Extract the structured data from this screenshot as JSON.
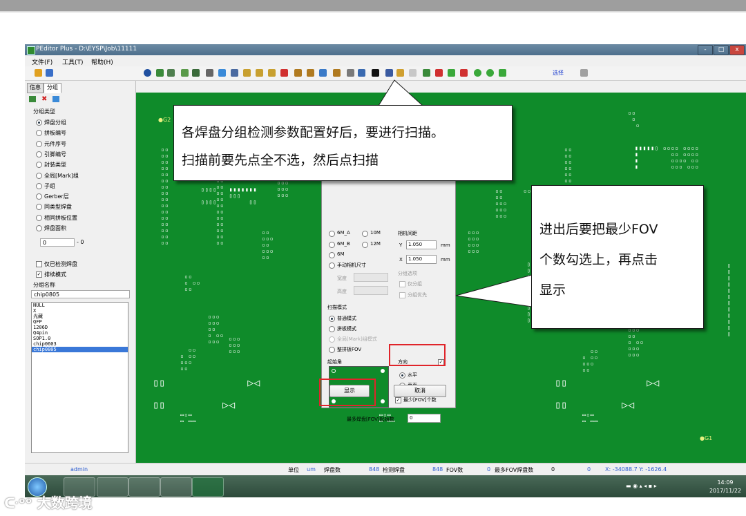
{
  "window": {
    "title": "PEditor Plus - D:\\EYSP\\Job\\11111",
    "min_label": "-",
    "max_label": "□",
    "close_label": "x"
  },
  "menu": {
    "file": "文件(F)",
    "tools": "工具(T)",
    "help": "帮助(H)"
  },
  "toolbar": {
    "select_label": "选择"
  },
  "left_panel": {
    "tabs": [
      "信息",
      "分组"
    ],
    "group_type_label": "分组类型",
    "group_types": [
      "焊盘分组",
      "拼板编号",
      "元件序号",
      "引脚编号",
      "封装类型",
      "全局[Mark]组",
      "子组",
      "Gerber层",
      "同类型焊盘",
      "相同拼板位置",
      "焊盘面积"
    ],
    "range_from": "0",
    "range_sep": "- 0",
    "only_detected": "仅已检测焊盘",
    "sort_mode": "排续模式",
    "group_name_label": "分组名称",
    "group_name_value": "chip0805",
    "list": [
      "NULL",
      "X",
      "光藏",
      "QFP",
      "1206D",
      "Q4pin",
      "SOP1.0",
      "chip0603",
      "chip0805"
    ],
    "admin": "admin"
  },
  "board": {
    "fid1": "G1",
    "fid2": "G2"
  },
  "dialog": {
    "opt_6a": "6M_A",
    "opt_6b": "6M_B",
    "opt_6m": "6M",
    "opt_10m": "10M",
    "opt_12m": "12M",
    "manual": "手动相机尺寸",
    "width": "宽度",
    "height": "高度",
    "cam_spacing": "相机间距",
    "y_label": "Y",
    "y_value": "1.050",
    "x_label": "X",
    "x_value": "1.050",
    "unit": "mm",
    "group_opts": "分组选项",
    "only_group": "仅分组",
    "group_priority": "分组优先",
    "scan_mode": "扫描模式",
    "modes": [
      "普通模式",
      "拼板模式",
      "全局[Mark]组模式",
      "整拼板FOV"
    ],
    "start_corner": "起始角",
    "direction": "方向",
    "horizontal": "水平",
    "vertical": "垂直",
    "min_fov": "最少[FOV]个数",
    "max_pads_label": "最多焊盘[FOV]起始数",
    "max_pads_value": "0",
    "show": "显示",
    "cancel": "取消"
  },
  "status": {
    "unit_label": "单位",
    "unit": "um",
    "pads_label": "焊盘数",
    "pads": "848",
    "detect_label": "检测焊盘",
    "detect": "848",
    "fov_label": "FOV数",
    "fov": "0",
    "max_fov_label": "最多FOV焊盘数",
    "max_fov": "0",
    "zero": "0",
    "coords": "X: -34088.7  Y: -1626.4"
  },
  "taskbar": {
    "time": "14:09",
    "date": "2017/11/22"
  },
  "callouts": {
    "top_line1": "各焊盘分组检测参数配置好后，要进行扫描。",
    "top_line2": "扫描前要先点全不选，然后点扫描",
    "right_line1": "进出后要把最少FOV",
    "right_line2": "个数勾选上，再点击",
    "right_line3": "显示"
  },
  "watermark": "大数跨境",
  "colors": {
    "board": "#0f8b2a",
    "highlight": "#e0242a",
    "selection": "#3a78d8"
  }
}
